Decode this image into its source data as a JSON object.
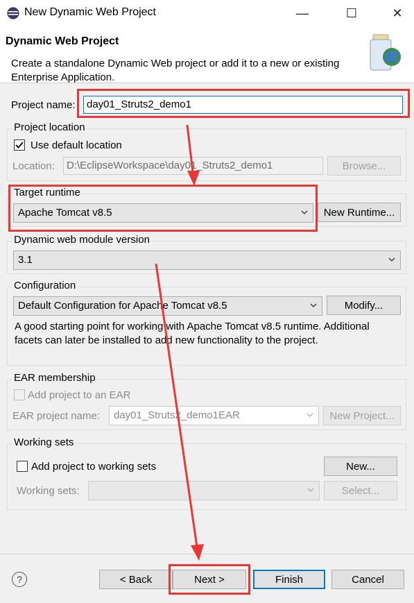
{
  "window": {
    "title": "New Dynamic Web Project",
    "controls": {
      "minimize": "—",
      "maximize": "☐",
      "close": "✕"
    }
  },
  "header": {
    "title": "Dynamic Web Project",
    "description": "Create a standalone Dynamic Web project or add it to a new or existing Enterprise Application."
  },
  "project_name": {
    "label": "Project name:",
    "value": "day01_Struts2_demo1"
  },
  "project_location": {
    "group_title": "Project location",
    "use_default_label": "Use default location",
    "use_default_checked": true,
    "location_label": "Location:",
    "location_value": "D:\\EclipseWorkspace\\day01_Struts2_demo1",
    "browse_label": "Browse..."
  },
  "target_runtime": {
    "group_title": "Target runtime",
    "selected": "Apache Tomcat v8.5",
    "new_runtime_label": "New Runtime..."
  },
  "module_version": {
    "group_title": "Dynamic web module version",
    "selected": "3.1"
  },
  "configuration": {
    "group_title": "Configuration",
    "selected": "Default Configuration for Apache Tomcat v8.5",
    "modify_label": "Modify...",
    "description": "A good starting point for working with Apache Tomcat v8.5 runtime. Additional facets can later be installed to add new functionality to the project."
  },
  "ear": {
    "group_title": "EAR membership",
    "add_label": "Add project to an EAR",
    "project_name_label": "EAR project name:",
    "project_name_value": "day01_Struts2_demo1EAR",
    "new_project_label": "New Project..."
  },
  "working_sets": {
    "group_title": "Working sets",
    "add_label": "Add project to working sets",
    "new_label": "New...",
    "sets_label": "Working sets:",
    "select_label": "Select..."
  },
  "footer": {
    "help_symbol": "?",
    "back_label": "< Back",
    "next_label": "Next >",
    "finish_label": "Finish",
    "cancel_label": "Cancel"
  },
  "colors": {
    "annotation": "#e53935",
    "focus": "#0078d7",
    "dialog_bg": "#f0f0f0"
  }
}
